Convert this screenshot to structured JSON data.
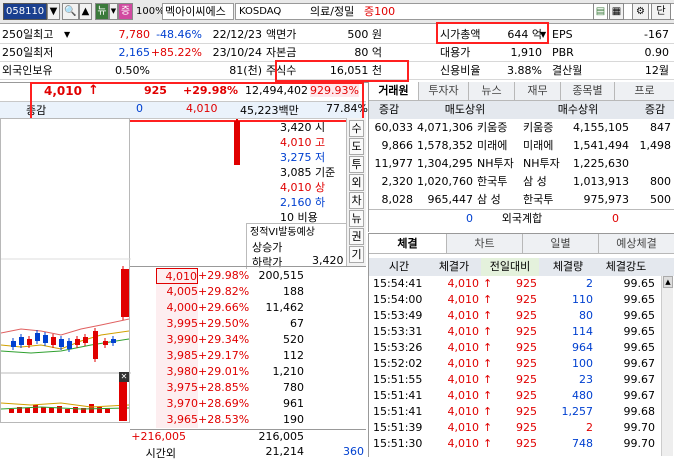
{
  "toolbar": {
    "code": "058110",
    "fund_label": "뉴",
    "margin_label": "증",
    "margin_pct": "100%",
    "name": "멕아이씨에스",
    "market": "KOSDAQ",
    "sector": "의료/정밀",
    "margin_rate": "증100",
    "side_btn": "단"
  },
  "summary": {
    "rows": [
      {
        "l": "250일최고",
        "v": "7,780",
        "p": "-48.46%",
        "d": "22/12/23",
        "l2": "액면가",
        "v2": "500 원",
        "l3": "시가총액",
        "v3": "644 억",
        "l4": "EPS",
        "v4": "-167"
      },
      {
        "l": "250일최저",
        "v": "2,165",
        "p": "+85.22%",
        "d": "23/10/24",
        "l2": "자본금",
        "v2": "80 억",
        "l3": "대용가",
        "v3": "1,910",
        "l4": "PBR",
        "v4": "0.90"
      },
      {
        "l": "외국인보유",
        "v": "0.50%",
        "p": "",
        "d": "81(천)",
        "l2": "주식수",
        "v2": "16,051 천",
        "l3": "신용비율",
        "v3": "3.88%",
        "l4": "결산월",
        "v4": "12월"
      }
    ]
  },
  "price": {
    "current": "4,010",
    "arrow": "↑",
    "change": "925",
    "pct": "+29.98%",
    "volume": "12,494,402",
    "vol_pct": "929.93%",
    "flag": "증감",
    "amt_change": "0",
    "amt": "4,010",
    "value": "45,223백만",
    "rate": "77.84%"
  },
  "side_info": {
    "lines": [
      "3,420 시",
      "4,010 고",
      "3,275 저",
      "3,085 기준",
      "4,010 상",
      "2,160 하",
      "10 비용"
    ],
    "vi_title": "정적VI발동예상",
    "vi_up": "상승가",
    "vi_down": "하락가",
    "vi_down_val": "3,420"
  },
  "side_tabs": [
    "수",
    "도",
    "투",
    "외",
    "차",
    "뉴",
    "권",
    "기"
  ],
  "orderbook": {
    "asks": [
      {
        "p": "4,010",
        "r": "+29.98%",
        "q": "200,515"
      },
      {
        "p": "4,005",
        "r": "+29.82%",
        "q": "188"
      },
      {
        "p": "4,000",
        "r": "+29.66%",
        "q": "11,462"
      },
      {
        "p": "3,995",
        "r": "+29.50%",
        "q": "67"
      },
      {
        "p": "3,990",
        "r": "+29.34%",
        "q": "520"
      }
    ],
    "bids": [
      {
        "p": "3,985",
        "r": "+29.17%",
        "q": "112"
      },
      {
        "p": "3,980",
        "r": "+29.01%",
        "q": "1,210"
      },
      {
        "p": "3,975",
        "r": "+28.85%",
        "q": "780"
      },
      {
        "p": "3,970",
        "r": "+28.69%",
        "q": "961"
      },
      {
        "p": "3,965",
        "r": "+28.53%",
        "q": "190"
      }
    ],
    "footer_change": "+216,005",
    "footer_total": "216,005",
    "after_label": "시간외",
    "after_total": "21,214",
    "after_right": "360"
  },
  "broker": {
    "tabs": [
      "거래원",
      "투자자",
      "뉴스",
      "재무",
      "종목별",
      "프로"
    ],
    "headers": [
      "증감",
      "매도상위",
      "매수상위",
      "증감"
    ],
    "rows": [
      {
        "sc": "60,033",
        "sq": "4,071,306",
        "sn": "키움증",
        "bn": "키움증",
        "bq": "4,155,105",
        "bc": "847"
      },
      {
        "sc": "9,866",
        "sq": "1,578,352",
        "sn": "미래에",
        "bn": "미래에",
        "bq": "1,541,494",
        "bc": "1,498"
      },
      {
        "sc": "11,977",
        "sq": "1,304,295",
        "sn": "NH투자",
        "bn": "NH투자",
        "bq": "1,225,630",
        "bc": ""
      },
      {
        "sc": "2,320",
        "sq": "1,020,760",
        "sn": "한국투",
        "bn": "삼 성",
        "bq": "1,013,913",
        "bc": "800"
      },
      {
        "sc": "8,028",
        "sq": "965,447",
        "sn": "삼 성",
        "bn": "한국투",
        "bq": "975,973",
        "bc": "500"
      }
    ],
    "foreign": {
      "l": "0",
      "label": "외국계합",
      "r": "0"
    }
  },
  "ticks": {
    "tabs": [
      "체결",
      "차트",
      "일별",
      "예상체결"
    ],
    "headers": [
      "시간",
      "체결가",
      "전일대비",
      "체결량",
      "체결강도"
    ],
    "rows": [
      {
        "t": "15:54:41",
        "p": "4,010",
        "c": "925",
        "q": "2",
        "s": "99.65",
        "qc": "blue"
      },
      {
        "t": "15:54:00",
        "p": "4,010",
        "c": "925",
        "q": "110",
        "s": "99.65",
        "qc": "blue"
      },
      {
        "t": "15:53:49",
        "p": "4,010",
        "c": "925",
        "q": "80",
        "s": "99.65",
        "qc": "blue"
      },
      {
        "t": "15:53:31",
        "p": "4,010",
        "c": "925",
        "q": "114",
        "s": "99.65",
        "qc": "blue"
      },
      {
        "t": "15:53:26",
        "p": "4,010",
        "c": "925",
        "q": "964",
        "s": "99.65",
        "qc": "blue"
      },
      {
        "t": "15:52:02",
        "p": "4,010",
        "c": "925",
        "q": "100",
        "s": "99.67",
        "qc": "blue"
      },
      {
        "t": "15:51:55",
        "p": "4,010",
        "c": "925",
        "q": "23",
        "s": "99.67",
        "qc": "blue"
      },
      {
        "t": "15:51:41",
        "p": "4,010",
        "c": "925",
        "q": "480",
        "s": "99.67",
        "qc": "blue"
      },
      {
        "t": "15:51:41",
        "p": "4,010",
        "c": "925",
        "q": "1,257",
        "s": "99.68",
        "qc": "blue"
      },
      {
        "t": "15:51:39",
        "p": "4,010",
        "c": "925",
        "q": "2",
        "s": "99.70",
        "qc": "red"
      },
      {
        "t": "15:51:30",
        "p": "4,010",
        "c": "925",
        "q": "748",
        "s": "99.70",
        "qc": "blue"
      }
    ]
  },
  "colors": {
    "up": "#e00000",
    "down": "#0040d0",
    "highlight": "#ff2020"
  }
}
